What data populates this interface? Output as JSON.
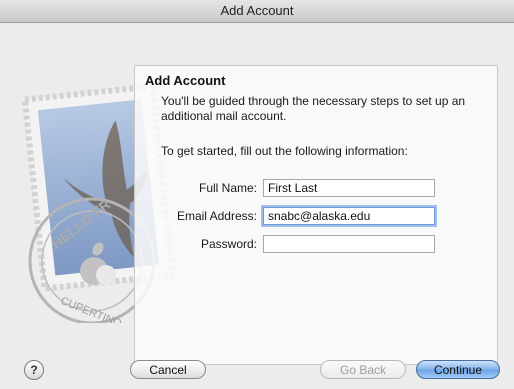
{
  "window": {
    "title": "Add Account"
  },
  "panel": {
    "heading": "Add Account",
    "intro": "You'll be guided through the necessary steps to set up an additional mail account.",
    "instruction": "To get started, fill out the following information:"
  },
  "form": {
    "full_name": {
      "label": "Full Name:",
      "value": "First Last"
    },
    "email": {
      "label": "Email Address:",
      "value": "snabc@alaska.edu"
    },
    "password": {
      "label": "Password:",
      "value": ""
    }
  },
  "stamp": {
    "text_top": "HELLO FR",
    "text_bottom": "CUPERTINO"
  },
  "buttons": {
    "help": "?",
    "cancel": "Cancel",
    "back": "Go Back",
    "continue": "Continue"
  },
  "colors": {
    "accent": "#6ea4e6",
    "focus_ring": "#9cc0ee"
  }
}
